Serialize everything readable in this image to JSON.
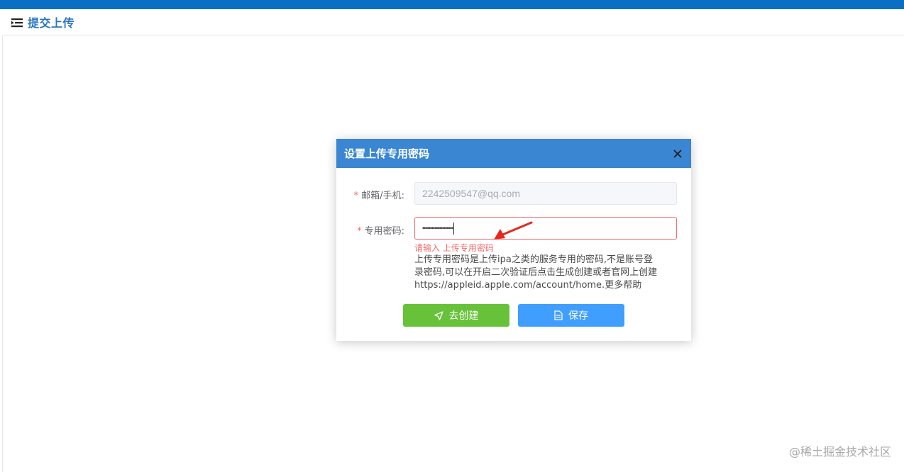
{
  "header": {
    "title": "提交上传"
  },
  "dialog": {
    "title": "设置上传专用密码",
    "email": {
      "required_mark": "*",
      "label": "邮箱/手机:",
      "value": "2242509547@qq.com"
    },
    "password": {
      "required_mark": "*",
      "label": "专用密码:",
      "value": "••••••••••••••••••••",
      "error": "请输入 上传专用密码"
    },
    "help_lines": [
      "上传专用密码是上传ipa之类的服务专用的密码,不是账号登",
      "录密码,可以在开启二次验证后点击生成创建或者官网上创建",
      "https://appleid.apple.com/account/home.更多帮助"
    ],
    "buttons": {
      "create": "去创建",
      "save": "保存"
    }
  },
  "watermark": "@稀土掘金技术社区",
  "colors": {
    "primary": "#3a86d3",
    "success": "#67c23a",
    "info": "#409eff",
    "danger": "#f56c6c",
    "topbar": "#0a6fc2"
  }
}
